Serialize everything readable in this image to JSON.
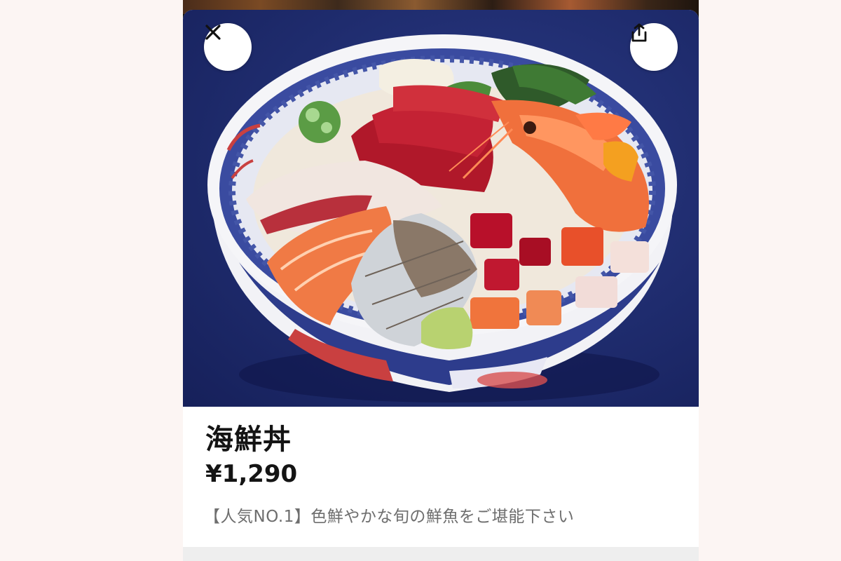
{
  "item": {
    "name": "海鮮丼",
    "price": "¥1,290",
    "description": "【人気NO.1】色鮮やかな旬の鮮魚をご堪能下さい"
  },
  "controls": {
    "close_icon": "close-icon",
    "share_icon": "share-icon"
  },
  "colors": {
    "photo_background": "#1f2c6e",
    "page_background": "#fcf5f3",
    "title_text": "#141414",
    "description_text": "#6e6e6e"
  }
}
